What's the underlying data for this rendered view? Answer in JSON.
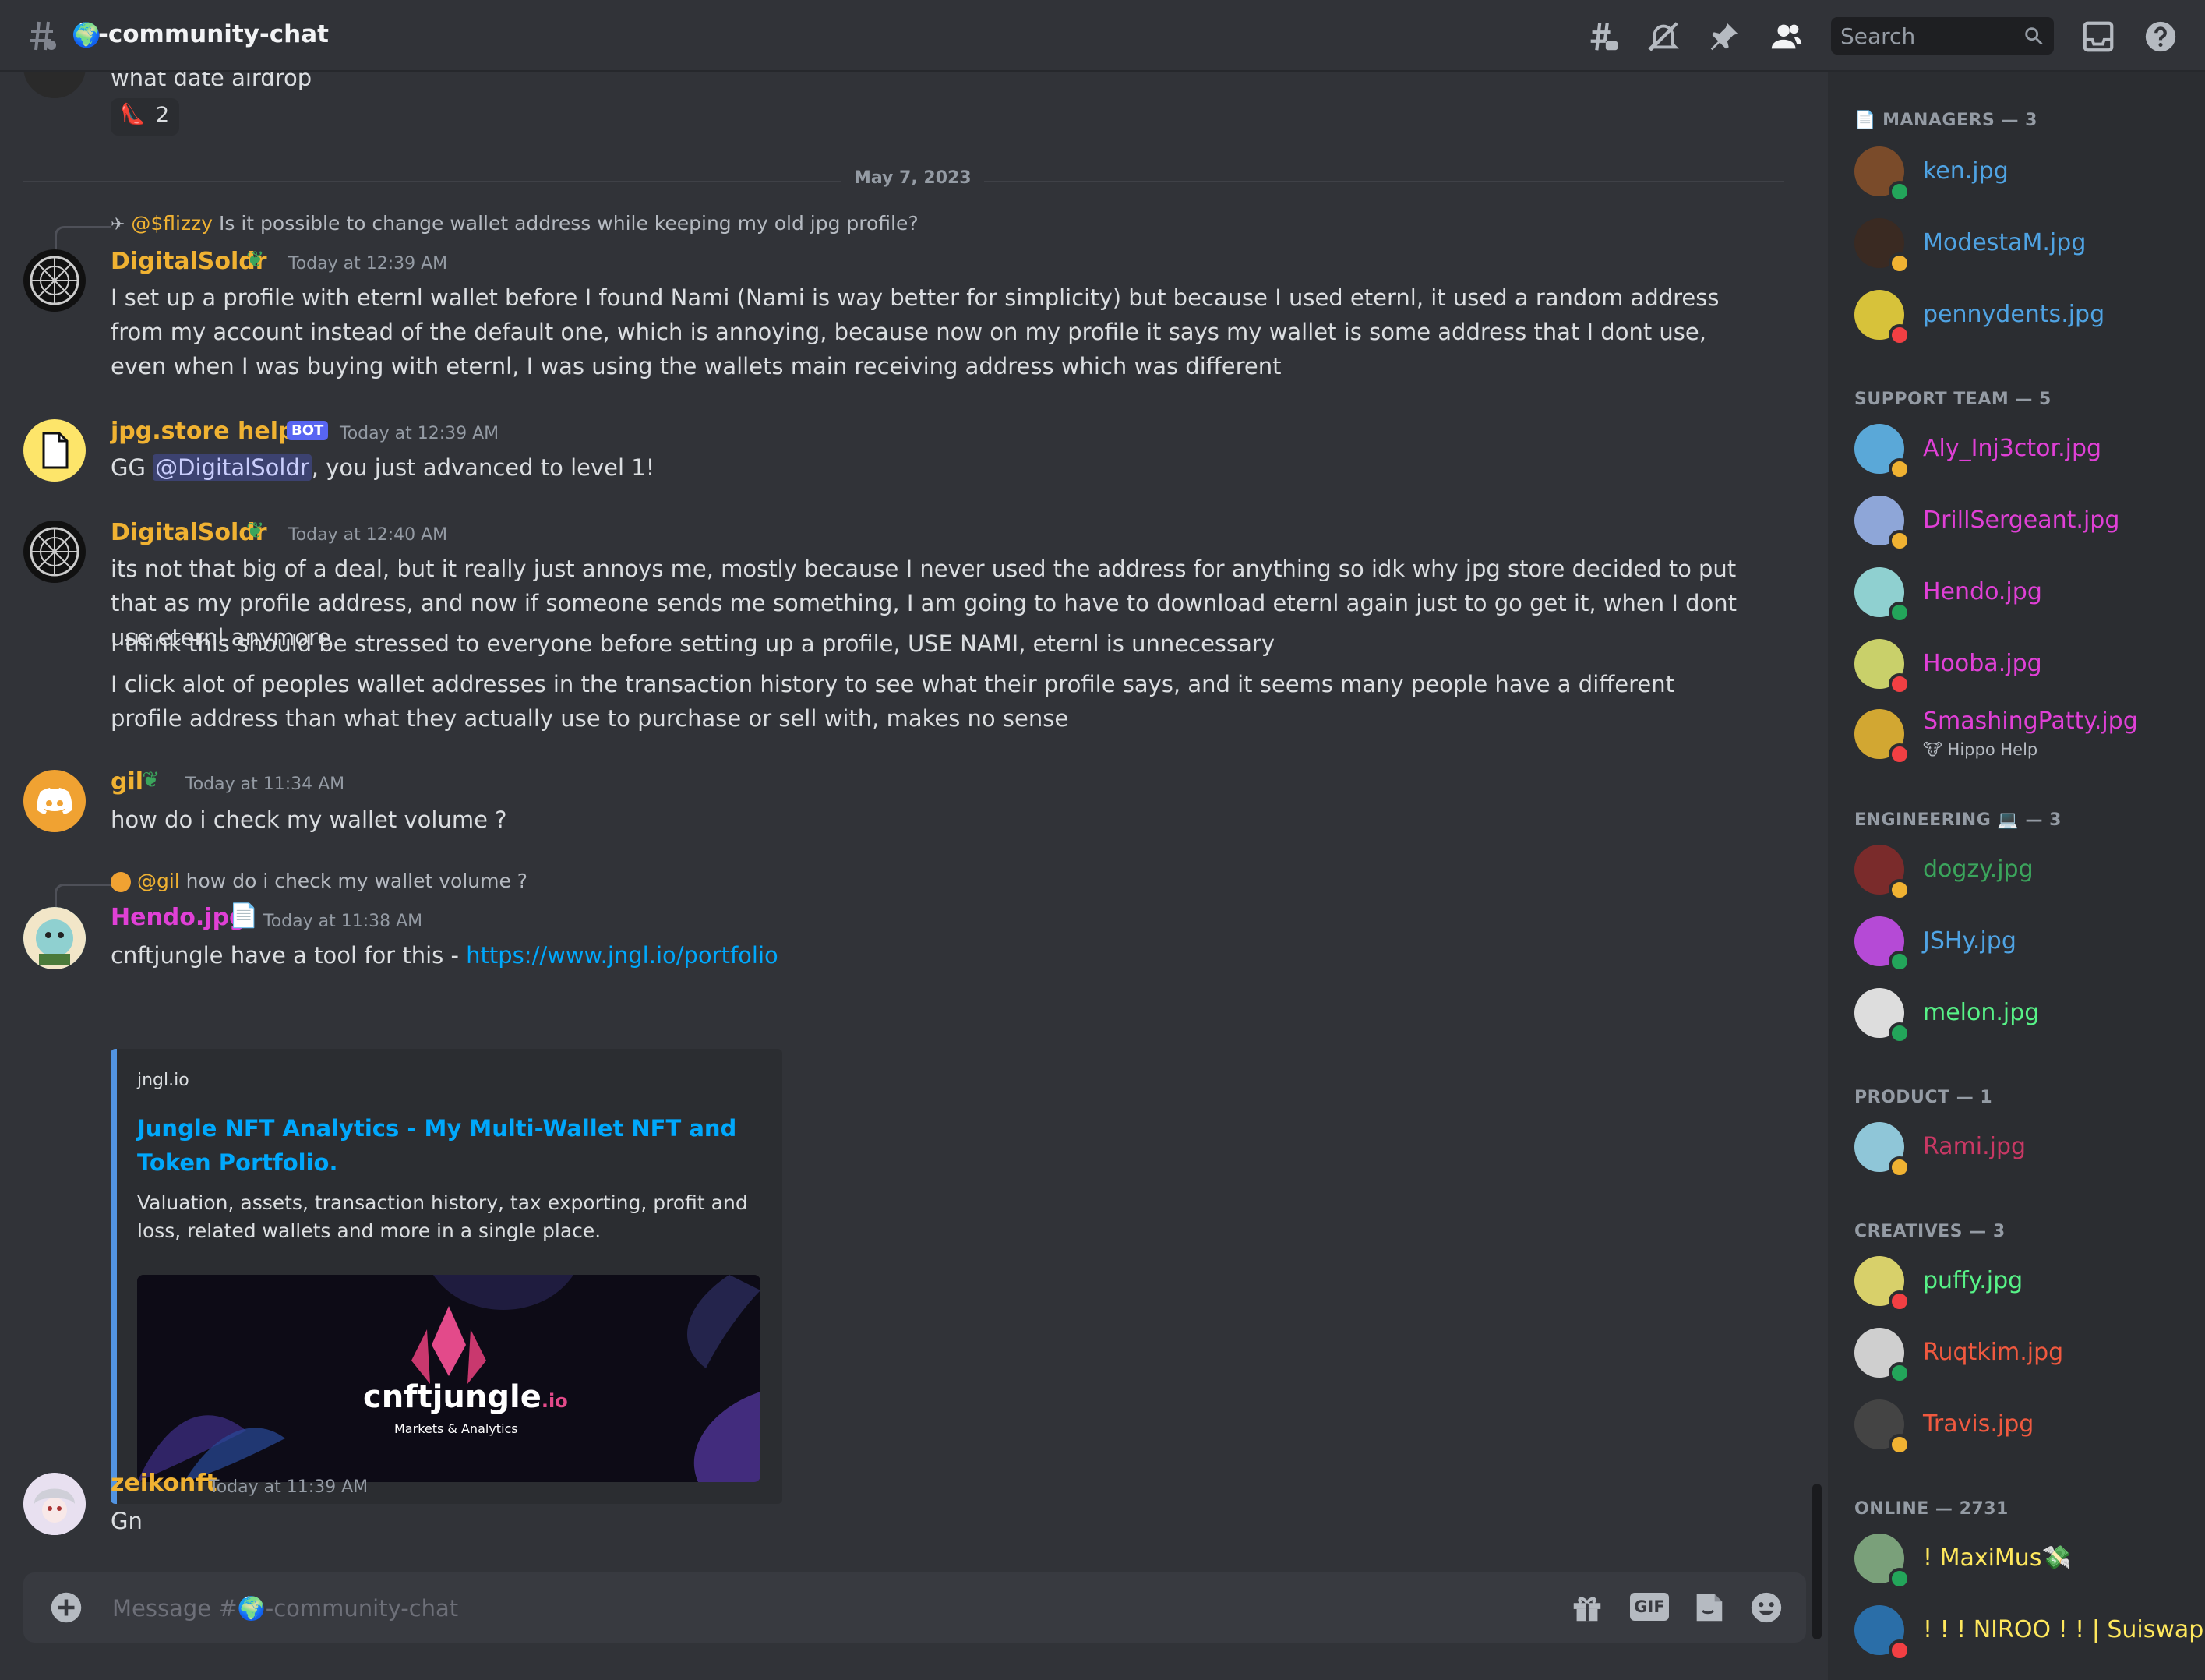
{
  "header": {
    "channel_emoji": "🌍",
    "channel_name": "-community-chat",
    "search_placeholder": "Search"
  },
  "chat": {
    "top_message": {
      "text": "what date airdrop",
      "reaction_emoji": "👠",
      "reaction_count": "2"
    },
    "date_divider": "May 7, 2023",
    "messages": [
      {
        "reply_to": "@$flizzy",
        "reply_text": "Is it possible to change wallet address while keeping my old jpg profile?",
        "author": "DigitalSoldr",
        "timestamp": "Today at 12:39 AM",
        "text": "I set up a profile with eternl wallet before I found Nami (Nami is way better for simplicity) but because I used eternl, it used a random address from my account instead of the default one, which is annoying, because now on my profile it says my wallet is some address that I dont use, even when I was buying with eternl, I was using the wallets main receiving address which was different"
      },
      {
        "author": "jpg.store helper",
        "bot_tag": "BOT",
        "timestamp": "Today at 12:39 AM",
        "text_prefix": "GG ",
        "mention": "@DigitalSoldr",
        "text_suffix": ", you just advanced to level 1!"
      },
      {
        "author": "DigitalSoldr",
        "timestamp": "Today at 12:40 AM",
        "lines": [
          "its not that big of a deal, but it really just annoys me, mostly because I never used the address for anything so idk why jpg store decided to put that as my profile address, and now if someone sends me something, I am going to have to download eternl again just to go get it, when I dont use eternl anymore",
          "I think this should be stressed to everyone before setting up a profile, USE NAMI, eternl is unnecessary",
          "I click alot of peoples wallet addresses in the transaction history to see what their profile says, and it seems many people have a different profile address than what they actually use to purchase or sell with, makes no sense"
        ]
      },
      {
        "author": "gil",
        "timestamp": "Today at 11:34 AM",
        "text": "how do i check my wallet volume ?"
      },
      {
        "reply_to": "@gil",
        "reply_text": "how do i check my wallet volume ?",
        "author": "Hendo.jpg",
        "timestamp": "Today at 11:38 AM",
        "text_prefix": "cnftjungle have a tool for this - ",
        "link": "https://www.jngl.io/portfolio",
        "embed": {
          "provider": "jngl.io",
          "title": "Jungle NFT Analytics - My Multi-Wallet NFT and Token Portfolio.",
          "description": "Valuation, assets, transaction history, tax exporting, profit and loss, related wallets and more in a single place.",
          "image_brand": "cnftjungle",
          "image_brand_suffix": ".io",
          "image_tagline": "Markets & Analytics"
        }
      },
      {
        "author": "zeikonft",
        "timestamp": "Today at 11:39 AM",
        "text": "Gn"
      }
    ]
  },
  "composer": {
    "placeholder": "Message #🌍-community-chat",
    "gif_label": "GIF"
  },
  "members": {
    "groups": [
      {
        "title": "MANAGERS — 3",
        "title_emoji": "📄",
        "members": [
          {
            "name": "ken.jpg",
            "color": "#4fa3e3",
            "status": "online",
            "avatar": "#7a4b2a"
          },
          {
            "name": "ModestaM.jpg",
            "color": "#4fa3e3",
            "status": "idle",
            "avatar": "#3a2a22"
          },
          {
            "name": "pennydents.jpg",
            "color": "#4fa3e3",
            "status": "dnd",
            "avatar": "#d7c23a"
          }
        ]
      },
      {
        "title": "SUPPORT TEAM — 5",
        "title_emoji": "",
        "members": [
          {
            "name": "Aly_Inj3ctor.jpg",
            "color": "#e040d6",
            "status": "idle",
            "avatar": "#5aa8d8"
          },
          {
            "name": "DrillSergeant.jpg",
            "color": "#e040d6",
            "status": "idle",
            "avatar": "#8ea6d8"
          },
          {
            "name": "Hendo.jpg",
            "color": "#e040d6",
            "status": "online",
            "avatar": "#8fd0d0"
          },
          {
            "name": "Hooba.jpg",
            "color": "#e040d6",
            "status": "dnd",
            "avatar": "#c9d06a"
          },
          {
            "name": "SmashingPatty.jpg",
            "color": "#e040d6",
            "status": "dnd",
            "avatar": "#d2a732",
            "activity": "Hippo Help",
            "activity_emoji": "🐮"
          }
        ]
      },
      {
        "title": "ENGINEERING 💻 — 3",
        "title_emoji": "",
        "members": [
          {
            "name": "dogzy.jpg",
            "color": "#3ba55c",
            "status": "idle",
            "avatar": "#7a2b2b"
          },
          {
            "name": "JSHy.jpg",
            "color": "#4fa3e3",
            "status": "online",
            "avatar": "#b54ad6"
          },
          {
            "name": "melon.jpg",
            "color": "#57f287",
            "status": "online",
            "avatar": "#dddddd"
          }
        ]
      },
      {
        "title": "PRODUCT — 1",
        "title_emoji": "",
        "members": [
          {
            "name": "Rami.jpg",
            "color": "#c93864",
            "status": "idle",
            "avatar": "#8fc6d8"
          }
        ]
      },
      {
        "title": "CREATIVES — 3",
        "title_emoji": "",
        "members": [
          {
            "name": "puffy.jpg",
            "color": "#57f287",
            "status": "dnd",
            "avatar": "#d8d06a"
          },
          {
            "name": "Ruqtkim.jpg",
            "color": "#f0593f",
            "status": "online",
            "avatar": "#cfcfcf"
          },
          {
            "name": "Travis.jpg",
            "color": "#f0593f",
            "status": "idle",
            "avatar": "#444444"
          }
        ]
      },
      {
        "title": "ONLINE — 2731",
        "title_emoji": "",
        "members": [
          {
            "name": "! MaxiMus💸",
            "color": "#fee75c",
            "status": "online",
            "avatar": "#7aa07a"
          },
          {
            "name": "! ! ! NIROO ! ! | Suiswap",
            "color": "#fee75c",
            "status": "dnd",
            "avatar": "#2a6ea8"
          }
        ]
      }
    ]
  }
}
